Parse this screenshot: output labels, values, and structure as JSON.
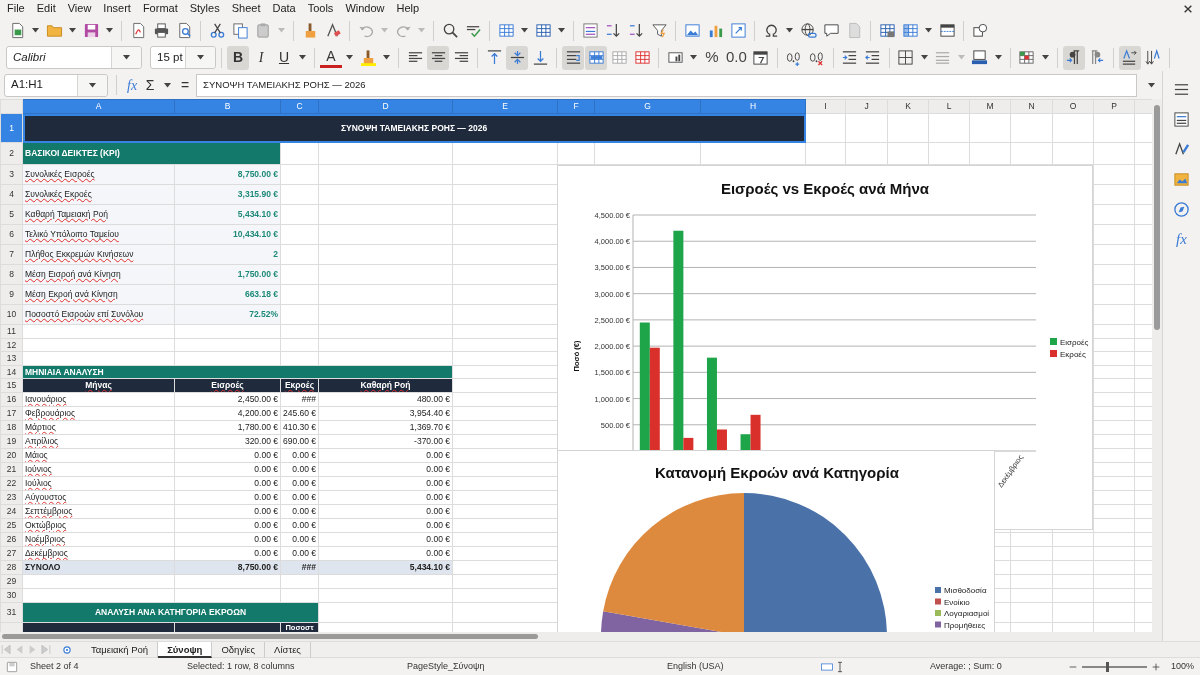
{
  "menu": [
    "File",
    "Edit",
    "View",
    "Insert",
    "Format",
    "Styles",
    "Sheet",
    "Data",
    "Tools",
    "Window",
    "Help"
  ],
  "format_toolbar": {
    "font_name": "Calibri",
    "font_size": "15 pt",
    "style_buttons": [
      {
        "label": "B",
        "pressed": true
      },
      {
        "label": "I",
        "pressed": false
      },
      {
        "label": "U",
        "pressed": false
      }
    ],
    "font_color_label": "A",
    "alignment": [
      {
        "pressed": false
      },
      {
        "pressed": true
      },
      {
        "pressed": false
      }
    ],
    "vertical_alignment": [
      {
        "pressed": false
      },
      {
        "pressed": true
      },
      {
        "pressed": false
      }
    ],
    "cell_buttons": [
      {
        "pressed": true
      },
      {
        "pressed": true
      },
      {
        "pressed": false
      },
      {
        "pressed": false
      }
    ],
    "number_labels": [
      "%",
      "0.0"
    ],
    "direction": [
      {
        "pressed": true
      },
      {
        "pressed": false
      }
    ],
    "text_orientation": [
      {
        "pressed": true
      },
      {
        "pressed": false
      }
    ]
  },
  "formula_bar": {
    "name_box": "A1:H1",
    "buttons": [
      "fx",
      "Σ",
      "="
    ],
    "content": "ΣΥΝΟΨΗ ΤΑΜΕΙΑΚΗΣ ΡΟΗΣ — 2026"
  },
  "columns": [
    {
      "label": "A",
      "selected": true
    },
    {
      "label": "B",
      "selected": true
    },
    {
      "label": "C",
      "selected": true
    },
    {
      "label": "D",
      "selected": true
    },
    {
      "label": "E",
      "selected": true
    },
    {
      "label": "F",
      "selected": true
    },
    {
      "label": "G",
      "selected": true
    },
    {
      "label": "H",
      "selected": true
    },
    {
      "label": "I",
      "selected": false
    },
    {
      "label": "J",
      "selected": false
    },
    {
      "label": "K",
      "selected": false
    },
    {
      "label": "L",
      "selected": false
    },
    {
      "label": "M",
      "selected": false
    },
    {
      "label": "N",
      "selected": false
    },
    {
      "label": "O",
      "selected": false
    },
    {
      "label": "P",
      "selected": false
    }
  ],
  "row_headers": [
    {
      "label": "1",
      "selected": true
    },
    {
      "label": "2",
      "selected": false
    },
    {
      "label": "3",
      "selected": false
    },
    {
      "label": "4",
      "selected": false
    },
    {
      "label": "5",
      "selected": false
    },
    {
      "label": "6",
      "selected": false
    },
    {
      "label": "7",
      "selected": false
    },
    {
      "label": "8",
      "selected": false
    },
    {
      "label": "9",
      "selected": false
    },
    {
      "label": "10",
      "selected": false
    },
    {
      "label": "11",
      "selected": false
    },
    {
      "label": "12",
      "selected": false
    },
    {
      "label": "13",
      "selected": false
    },
    {
      "label": "14",
      "selected": false
    },
    {
      "label": "15",
      "selected": false
    },
    {
      "label": "16",
      "selected": false
    },
    {
      "label": "17",
      "selected": false
    },
    {
      "label": "18",
      "selected": false
    },
    {
      "label": "19",
      "selected": false
    },
    {
      "label": "20",
      "selected": false
    },
    {
      "label": "21",
      "selected": false
    },
    {
      "label": "22",
      "selected": false
    },
    {
      "label": "23",
      "selected": false
    },
    {
      "label": "24",
      "selected": false
    },
    {
      "label": "25",
      "selected": false
    },
    {
      "label": "26",
      "selected": false
    },
    {
      "label": "27",
      "selected": false
    },
    {
      "label": "28",
      "selected": false
    },
    {
      "label": "29",
      "selected": false
    },
    {
      "label": "30",
      "selected": false
    },
    {
      "label": "31",
      "selected": false
    }
  ],
  "sheet": {
    "title": "ΣΥΝΟΨΗ ΤΑΜΕΙΑΚΗΣ ΡΟΗΣ — 2026",
    "title_selected": true,
    "kpi": {
      "heading": "ΒΑΣΙΚΟΙ ΔΕΙΚΤΕΣ (KPI)",
      "items": [
        {
          "label": "Συνολικές Εισροές",
          "value": "8,750.00 €"
        },
        {
          "label": "Συνολικές Εκροές",
          "value": "3,315.90 €"
        },
        {
          "label": "Καθαρή Ταμειακή Ροή",
          "value": "5,434.10 €"
        },
        {
          "label": "Τελικό Υπόλοιπο Ταμείου",
          "value": "10,434.10 €"
        },
        {
          "label": "Πλήθος Εκκρεμών Κινήσεων",
          "value": "2"
        },
        {
          "label": "Μέση Εισροή ανά Κίνηση",
          "value": "1,750.00 €"
        },
        {
          "label": "Μέση Εκροή ανά Κίνηση",
          "value": "663.18 €"
        },
        {
          "label": "Ποσοστό Εισροών επί Συνόλου",
          "value": "72.52%"
        }
      ]
    },
    "monthly": {
      "heading": "ΜΗΝΙΑΙΑ ΑΝΑΛΥΣΗ",
      "columns": [
        "Μήνας",
        "Εισροές",
        "Εκροές",
        "Καθαρή Ροή"
      ],
      "rows": [
        [
          "Ιανουάριος",
          "2,450.00 €",
          "###",
          "480.00 €"
        ],
        [
          "Φεβρουάριος",
          "4,200.00 €",
          "245.60 €",
          "3,954.40 €"
        ],
        [
          "Μάρτιος",
          "1,780.00 €",
          "410.30 €",
          "1,369.70 €"
        ],
        [
          "Απρίλιος",
          "320.00 €",
          "690.00 €",
          "-370.00 €"
        ],
        [
          "Μάιος",
          "0.00 €",
          "0.00 €",
          "0.00 €"
        ],
        [
          "Ιούνιος",
          "0.00 €",
          "0.00 €",
          "0.00 €"
        ],
        [
          "Ιούλιος",
          "0.00 €",
          "0.00 €",
          "0.00 €"
        ],
        [
          "Αύγουστος",
          "0.00 €",
          "0.00 €",
          "0.00 €"
        ],
        [
          "Σεπτέμβριος",
          "0.00 €",
          "0.00 €",
          "0.00 €"
        ],
        [
          "Οκτώβριος",
          "0.00 €",
          "0.00 €",
          "0.00 €"
        ],
        [
          "Νοέμβριος",
          "0.00 €",
          "0.00 €",
          "0.00 €"
        ],
        [
          "Δεκέμβριος",
          "0.00 €",
          "0.00 €",
          "0.00 €"
        ]
      ],
      "total": [
        "ΣΥΝΟΛΟ",
        "8,750.00 €",
        "###",
        "5,434.10 €"
      ]
    },
    "category": {
      "heading": "ΑΝΑΛΥΣΗ ΑΝΑ ΚΑΤΗΓΟΡΙΑ ΕΚΡΟΩΝ",
      "column_3": "Ποσοστ"
    }
  },
  "monthly_chart": {
    "chart_data": {
      "type": "bar",
      "title": "Εισροές vs Εκροές ανά Μήνα",
      "ylabel": "Ποσό (€)",
      "categories": [
        null,
        null,
        null,
        null,
        null,
        null,
        null,
        null,
        null,
        null,
        null,
        "Δεκέμβριος"
      ],
      "grid": true,
      "legend": true,
      "series": [
        {
          "name": "Εισροές",
          "color": "#1ea54a",
          "values": [
            2450,
            4200,
            1780,
            320,
            0,
            0,
            0,
            0,
            0,
            0,
            0,
            0
          ]
        },
        {
          "name": "Εκροές",
          "color": "#d9302c",
          "values": [
            1970,
            250,
            410,
            690,
            0,
            0,
            0,
            0,
            0,
            0,
            0,
            0
          ]
        }
      ],
      "ylim": [
        0,
        4500
      ],
      "yticks": [
        {
          "value": 500,
          "label": "500.00 €"
        },
        {
          "value": 1000,
          "label": "1,000.00 €"
        },
        {
          "value": 1500,
          "label": "1,500.00 €"
        },
        {
          "value": 2000,
          "label": "2,000.00 €"
        },
        {
          "value": 2500,
          "label": "2,500.00 €"
        },
        {
          "value": 3000,
          "label": "3,000.00 €"
        },
        {
          "value": 3500,
          "label": "3,500.00 €"
        },
        {
          "value": 4000,
          "label": "4,000.00 €"
        },
        {
          "value": 4500,
          "label": "4,500.00 €"
        }
      ]
    }
  },
  "category_chart": {
    "title": "Κατανομή Εκροών ανά Κατηγορία",
    "kind": "picture",
    "legend": [
      {
        "name": "Μισθοδοσία",
        "color": "#4a72a8"
      },
      {
        "name": "Ενοίκιο",
        "color": "#c0504d"
      },
      {
        "name": "Λογαριασμοί",
        "color": "#9bbb59"
      },
      {
        "name": "Προμήθειες",
        "color": "#8064a2"
      }
    ]
  },
  "sidebar": {
    "functions_label": "fx"
  },
  "sheet_tabs": [
    {
      "label": "Ταμειακή Ροή",
      "selected": false
    },
    {
      "label": "Σύνοψη",
      "selected": true
    },
    {
      "label": "Οδηγίες",
      "selected": false
    },
    {
      "label": "Λίστες",
      "selected": false
    }
  ],
  "status_bar": {
    "sheet": "Sheet 2 of 4",
    "selection": "Selected: 1 row, 8 columns",
    "page_style": "PageStyle_Σύνοψη",
    "language": "English (USA)",
    "sum": "Average: ; Sum: 0",
    "zoom": "100%",
    "zoom_slider": {
      "level": 0.37
    }
  }
}
